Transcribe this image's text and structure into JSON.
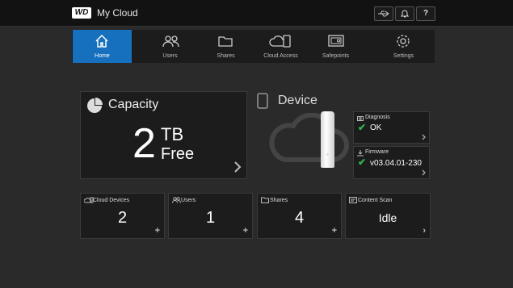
{
  "header": {
    "app_title": "My Cloud",
    "logo_text": "WD"
  },
  "topbar": {
    "usb_icon": "usb-icon",
    "notification_icon": "bell-icon",
    "help_label": "?"
  },
  "nav": {
    "items": [
      {
        "label": "Home",
        "icon": "home-icon",
        "active": true
      },
      {
        "label": "Users",
        "icon": "users-icon"
      },
      {
        "label": "Shares",
        "icon": "folder-icon"
      },
      {
        "label": "Cloud Access",
        "icon": "cloud-device-icon"
      },
      {
        "label": "Safepoints",
        "icon": "safe-icon"
      },
      {
        "label": "Settings",
        "icon": "gear-icon"
      }
    ]
  },
  "capacity": {
    "title": "Capacity",
    "value": "2",
    "unit": "TB",
    "status": "Free"
  },
  "device": {
    "title": "Device",
    "diagnosis": {
      "title": "Diagnosis",
      "value": "OK"
    },
    "firmware": {
      "title": "Firmware",
      "value": "v03.04.01-230"
    }
  },
  "bottom": [
    {
      "title": "Cloud Devices",
      "value": "2",
      "action": "+"
    },
    {
      "title": "Users",
      "value": "1",
      "action": "+"
    },
    {
      "title": "Shares",
      "value": "4",
      "action": "+"
    },
    {
      "title": "Content Scan",
      "value": "Idle",
      "action": "›"
    }
  ],
  "colors": {
    "accent": "#1670bd",
    "ok": "#34b34a",
    "background": "#2a2a2a",
    "panel": "#1c1c1c"
  }
}
